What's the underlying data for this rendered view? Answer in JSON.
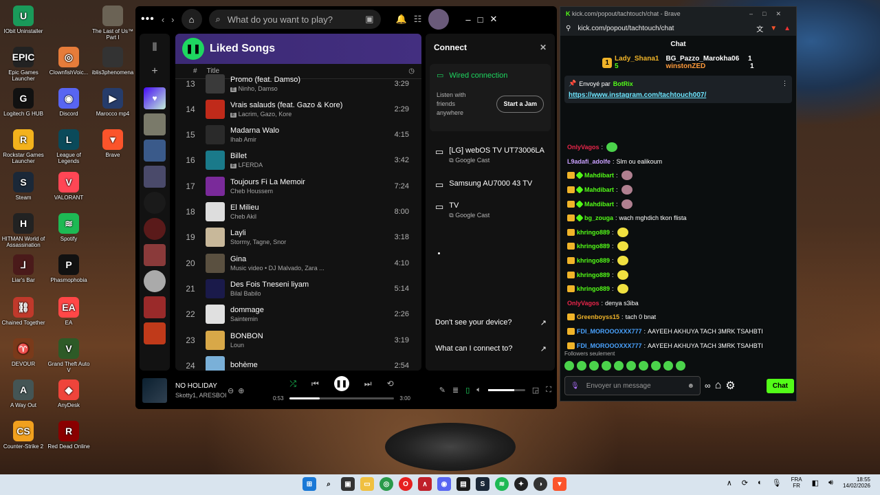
{
  "desktop": {
    "icons": [
      {
        "label": "IObit Uninstaller",
        "color": "#1a9a5a",
        "glyph": "U"
      },
      {
        "label": "The Last of Us™ Part I",
        "color": "#6b6355",
        "glyph": ""
      },
      {
        "label": "Epic Games Launcher",
        "color": "#222",
        "glyph": "EPIC"
      },
      {
        "label": "ClownfishVoic...",
        "color": "#e67c3a",
        "glyph": "◎"
      },
      {
        "label": "iblis3phenomena",
        "color": "#333",
        "glyph": ""
      },
      {
        "label": "Logitech G HUB",
        "color": "#111",
        "glyph": "G"
      },
      {
        "label": "Discord",
        "color": "#5865f2",
        "glyph": "◉"
      },
      {
        "label": "Marocco mp4",
        "color": "#263c6a",
        "glyph": "▶"
      },
      {
        "label": "Rockstar Games Launcher",
        "color": "#f3b21c",
        "glyph": "R"
      },
      {
        "label": "League of Legends",
        "color": "#0a4a5a",
        "glyph": "L"
      },
      {
        "label": "Brave",
        "color": "#fb542b",
        "glyph": "▼"
      },
      {
        "label": "Steam",
        "color": "#1b2838",
        "glyph": "S"
      },
      {
        "label": "VALORANT",
        "color": "#ff4655",
        "glyph": "V"
      },
      {
        "label": "HITMAN World of Assassination",
        "color": "#222",
        "glyph": "H"
      },
      {
        "label": "Spotify",
        "color": "#1db954",
        "glyph": "≋"
      },
      {
        "label": "Liar's Bar",
        "color": "#4a1a1a",
        "glyph": "⅃"
      },
      {
        "label": "Phasmophobia",
        "color": "#111",
        "glyph": "P"
      },
      {
        "label": "Chained Together",
        "color": "#c0392b",
        "glyph": "⛓"
      },
      {
        "label": "EA",
        "color": "#ff4747",
        "glyph": "EA"
      },
      {
        "label": "DEVOUR",
        "color": "#7a3a1a",
        "glyph": "♈"
      },
      {
        "label": "Grand Theft Auto V",
        "color": "#2d5a27",
        "glyph": "V"
      },
      {
        "label": "A Way Out",
        "color": "#455",
        "glyph": "A"
      },
      {
        "label": "AnyDesk",
        "color": "#ef443b",
        "glyph": "◆"
      },
      {
        "label": "Counter-Strike 2",
        "color": "#f1a01e",
        "glyph": "CS"
      },
      {
        "label": "Red Dead Online",
        "color": "#8a0000",
        "glyph": "R"
      }
    ]
  },
  "spotify": {
    "search_placeholder": "What do you want to play?",
    "playlist_title": "Liked Songs",
    "col_hash": "#",
    "col_title": "Title",
    "tracks": [
      {
        "n": "13",
        "title": "Promo (feat. Damso)",
        "artist": "Ninho, Damso",
        "explicit": true,
        "dur": "3:29",
        "color": "#3a3a3a"
      },
      {
        "n": "14",
        "title": "Vrais salauds (feat. Gazo & Kore)",
        "artist": "Lacrim, Gazo, Kore",
        "explicit": true,
        "dur": "2:29",
        "color": "#c02a1a"
      },
      {
        "n": "15",
        "title": "Madarna Walo",
        "artist": "Ihab Amir",
        "explicit": false,
        "dur": "4:15",
        "color": "#2a2a2a"
      },
      {
        "n": "16",
        "title": "Billet",
        "artist": "LFERDA",
        "explicit": true,
        "dur": "3:42",
        "color": "#1a7a8a"
      },
      {
        "n": "17",
        "title": "Toujours Fi La Memoir",
        "artist": "Cheb Houssem",
        "explicit": false,
        "dur": "7:24",
        "color": "#7a2a9a"
      },
      {
        "n": "18",
        "title": "El Milieu",
        "artist": "Cheb Akil",
        "explicit": false,
        "dur": "8:00",
        "color": "#ddd"
      },
      {
        "n": "19",
        "title": "Layli",
        "artist": "Stormy, Tagne, Snor",
        "explicit": false,
        "dur": "3:18",
        "color": "#c8b89a"
      },
      {
        "n": "20",
        "title": "Gina",
        "artist": "Music video • DJ Malvado, Zara ...",
        "explicit": false,
        "dur": "4:10",
        "color": "#5a5040"
      },
      {
        "n": "21",
        "title": "Des Fois Tneseni liyam",
        "artist": "Bilal Babilo",
        "explicit": false,
        "dur": "5:14",
        "color": "#1a1a4a"
      },
      {
        "n": "22",
        "title": "dommage",
        "artist": "Saintemin",
        "explicit": false,
        "dur": "2:26",
        "color": "#e0e0e0"
      },
      {
        "n": "23",
        "title": "BONBON",
        "artist": "Loun",
        "explicit": false,
        "dur": "3:19",
        "color": "#d8a848"
      },
      {
        "n": "24",
        "title": "bohème",
        "artist": "",
        "explicit": false,
        "dur": "2:54",
        "color": "#7ab0d8"
      }
    ],
    "connect": {
      "title": "Connect",
      "wired": "Wired connection",
      "listen": "Listen with friends anywhere",
      "jam": "Start a Jam",
      "devices": [
        {
          "name": "[LG] webOS TV UT73006LA",
          "sub": "Google Cast"
        },
        {
          "name": "Samsung AU7000 43 TV",
          "sub": ""
        },
        {
          "name": "TV",
          "sub": "Google Cast"
        }
      ],
      "link1": "Don't see your device?",
      "link2": "What can I connect to?"
    },
    "now_playing": {
      "title": "NO HOLIDAY",
      "artist": "Skotty1, ARESBOI",
      "elapsed": "0:53",
      "total": "3:00",
      "progress": 0.29,
      "volume": 0.7
    }
  },
  "brave": {
    "title": "kick.com/popout/tachtouch/chat - Brave",
    "url": "kick.com/popout/tachtouch/chat",
    "chat_header": "Chat",
    "leaders": [
      {
        "rank": "1",
        "name": "Lady_Shana1",
        "count": "5"
      },
      {
        "name": "BG_Pazzo_Marokha06",
        "count": "1"
      },
      {
        "name": "winstonZED",
        "count": "1"
      }
    ],
    "pinned_by": "Envoyé par",
    "pinned_user": "BotRix",
    "pinned_url": "https://www.instagram.com/tachtouch007/",
    "messages": [
      {
        "user": "OnlyVagos",
        "color": "#e8254a",
        "text": "",
        "emote": true,
        "badges": 0
      },
      {
        "user": "L9adafi_adolfe",
        "color": "#c9a0ff",
        "text": "Slm ou ealikoum",
        "emote": false,
        "badges": 0
      },
      {
        "user": "Mahdibart",
        "color": "#53fc18",
        "text": "",
        "emote": true,
        "badges": 2
      },
      {
        "user": "Mahdibart",
        "color": "#53fc18",
        "text": "",
        "emote": true,
        "badges": 2
      },
      {
        "user": "Mahdibart",
        "color": "#53fc18",
        "text": "",
        "emote": true,
        "badges": 2
      },
      {
        "user": "bg_zouga",
        "color": "#53fc18",
        "text": "wach mghdich tkon flista",
        "emote": false,
        "badges": 2
      },
      {
        "user": "khringo889",
        "color": "#53fc18",
        "text": "",
        "emote": true,
        "badges": 1
      },
      {
        "user": "khringo889",
        "color": "#53fc18",
        "text": "",
        "emote": true,
        "badges": 1
      },
      {
        "user": "khringo889",
        "color": "#53fc18",
        "text": "",
        "emote": true,
        "badges": 1
      },
      {
        "user": "khringo889",
        "color": "#53fc18",
        "text": "",
        "emote": true,
        "badges": 1
      },
      {
        "user": "khringo889",
        "color": "#53fc18",
        "text": "",
        "emote": true,
        "badges": 1
      },
      {
        "user": "OnlyVagos",
        "color": "#e8254a",
        "text": "denya s3iba",
        "emote": false,
        "badges": 0
      },
      {
        "user": "Greenboyss15",
        "color": "#f0b429",
        "text": "tach 0 bnat",
        "emote": false,
        "badges": 1
      },
      {
        "user": "FDI_MOROOOXXX777",
        "color": "#4aa3ff",
        "text": "AAYEEH AKHUYA TACH 3MRK TSAHBTI",
        "emote": false,
        "badges": 1
      },
      {
        "user": "FDI_MOROOOXXX777",
        "color": "#4aa3ff",
        "text": "AAYEEH AKHUYA TACH 3MRK TSAHBTI",
        "emote": false,
        "badges": 1
      }
    ],
    "followers_only": "Followers seulement",
    "input_placeholder": "Envoyer un message",
    "chat_button": "Chat"
  },
  "taskbar": {
    "lang1": "FRA",
    "lang2": "FR",
    "time": "18:55",
    "date": "14/02/2026"
  }
}
